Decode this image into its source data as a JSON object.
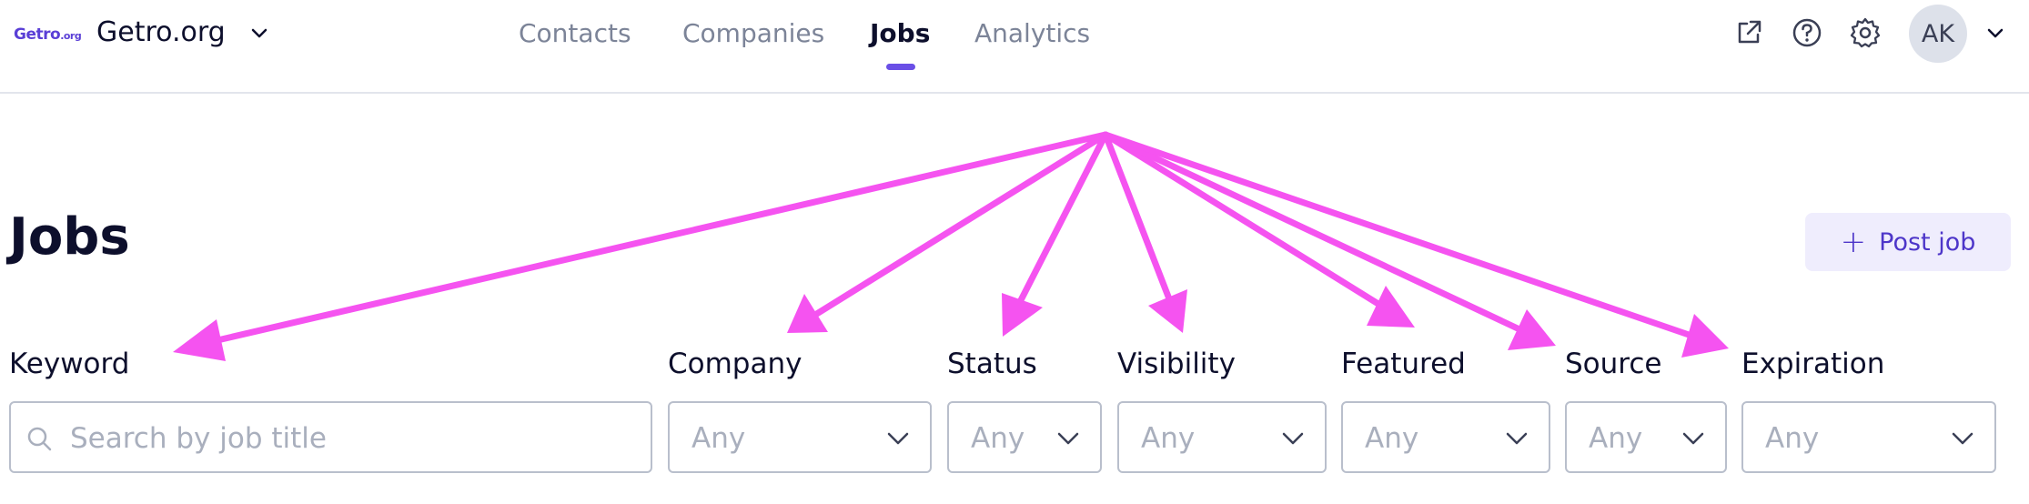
{
  "header": {
    "logo_text": "Getro",
    "logo_suffix": ".org",
    "org_name": "Getro.org",
    "nav": [
      {
        "label": "Contacts",
        "active": false
      },
      {
        "label": "Companies",
        "active": false
      },
      {
        "label": "Jobs",
        "active": true
      },
      {
        "label": "Analytics",
        "active": false
      }
    ],
    "icons": [
      "external-link-icon",
      "help-icon",
      "settings-icon"
    ],
    "avatar_initials": "AK"
  },
  "page": {
    "title": "Jobs",
    "post_job_label": "Post job"
  },
  "filters": {
    "keyword": {
      "label": "Keyword",
      "placeholder": "Search by job title"
    },
    "company": {
      "label": "Company",
      "value": "Any"
    },
    "status": {
      "label": "Status",
      "value": "Any"
    },
    "visibility": {
      "label": "Visibility",
      "value": "Any"
    },
    "featured": {
      "label": "Featured",
      "value": "Any"
    },
    "source": {
      "label": "Source",
      "value": "Any"
    },
    "expiration": {
      "label": "Expiration",
      "value": "Any"
    }
  },
  "colors": {
    "accent": "#6a4fe6",
    "annotation_arrow": "#f553f0",
    "button_bg": "#efedfd"
  }
}
